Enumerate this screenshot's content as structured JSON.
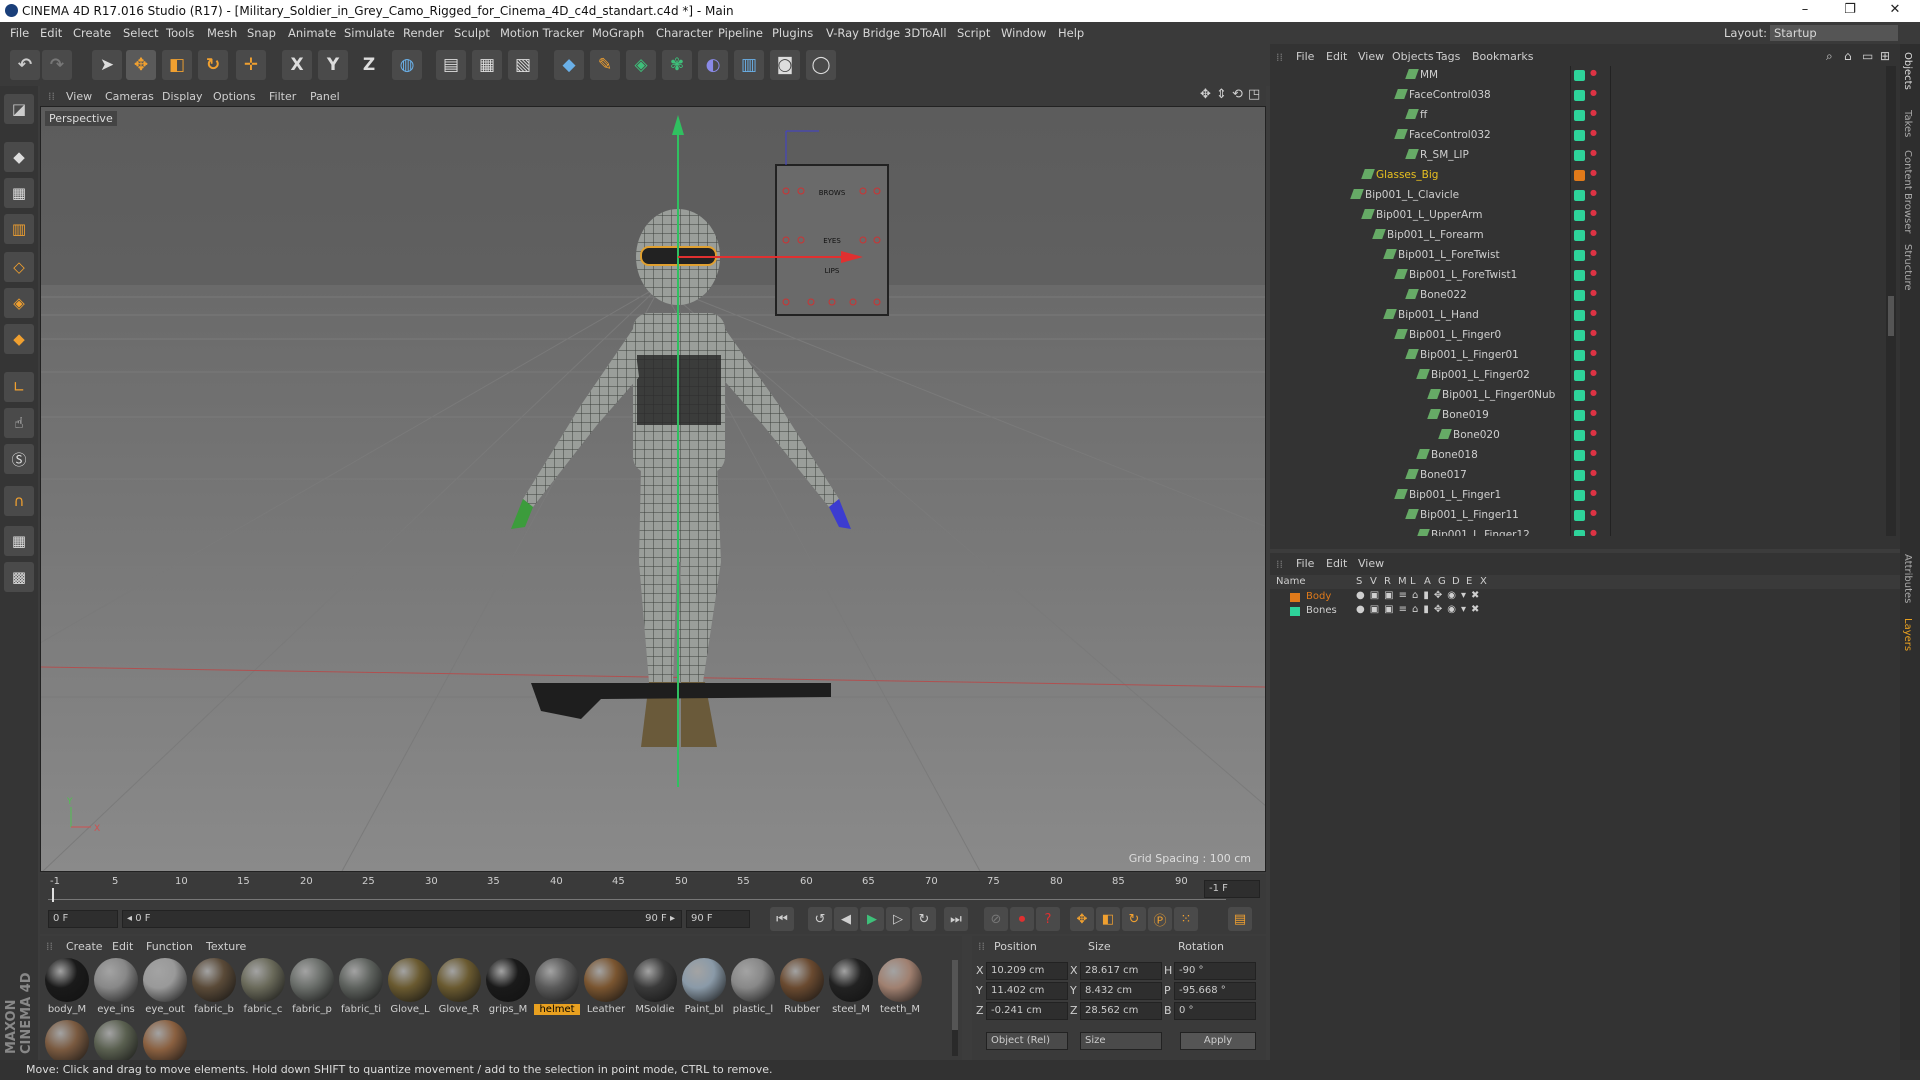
{
  "window": {
    "title": "CINEMA 4D R17.016 Studio (R17) - [Military_Soldier_in_Grey_Camo_Rigged_for_Cinema_4D_c4d_standart.c4d *] - Main",
    "minimize": "–",
    "restore": "❐",
    "close": "✕"
  },
  "menu": [
    "File",
    "Edit",
    "Create",
    "Select",
    "Tools",
    "Mesh",
    "Snap",
    "Animate",
    "Simulate",
    "Render",
    "Sculpt",
    "Motion Tracker",
    "MoGraph",
    "Character",
    "Pipeline",
    "Plugins",
    "V-Ray Bridge",
    "3DToAll",
    "Script",
    "Window",
    "Help"
  ],
  "layout": {
    "label": "Layout:",
    "value": "Startup"
  },
  "toolbar": {
    "x": "X",
    "y": "Y",
    "z": "Z"
  },
  "viewport": {
    "menu": [
      "View",
      "Cameras",
      "Display",
      "Options",
      "Filter",
      "Panel"
    ],
    "name": "Perspective",
    "grid_spacing": "Grid Spacing : 100 cm",
    "axis_y": "Y",
    "axis_x": "X",
    "face_panel": [
      "BROWS",
      "EYES",
      "LIPS"
    ]
  },
  "timeline": {
    "ticks": [
      "-1",
      "5",
      "10",
      "15",
      "20",
      "25",
      "30",
      "35",
      "40",
      "45",
      "50",
      "55",
      "60",
      "65",
      "70",
      "75",
      "80",
      "85",
      "90"
    ],
    "end": "-1 F"
  },
  "playback": {
    "current": "0 F",
    "range_start": "◂ 0 F",
    "range_end": "90 F ▸",
    "end": "90 F"
  },
  "materials": {
    "menu": [
      "Create",
      "Edit",
      "Function",
      "Texture"
    ],
    "items": [
      {
        "name": "body_M",
        "color": "#1a1a1a"
      },
      {
        "name": "eye_ins",
        "color": "#888"
      },
      {
        "name": "eye_out",
        "color": "#999"
      },
      {
        "name": "fabric_b",
        "color": "#5a4a38"
      },
      {
        "name": "fabric_c",
        "color": "#6a6a5a"
      },
      {
        "name": "fabric_p",
        "color": "#6a6e6a"
      },
      {
        "name": "fabric_ti",
        "color": "#5e625e"
      },
      {
        "name": "Glove_L",
        "color": "#6a5a30"
      },
      {
        "name": "Glove_R",
        "color": "#6a5a30"
      },
      {
        "name": "grips_M",
        "color": "#1a1a1a"
      },
      {
        "name": "helmet",
        "color": "#5a5a5a"
      },
      {
        "name": "Leather",
        "color": "#7a5530"
      },
      {
        "name": "MSoldie",
        "color": "#3a3a3a"
      },
      {
        "name": "Paint_bl",
        "color": "#8a9aa8"
      },
      {
        "name": "plastic_l",
        "color": "#888"
      },
      {
        "name": "Rubber",
        "color": "#6a4a30"
      },
      {
        "name": "steel_M",
        "color": "#222"
      },
      {
        "name": "teeth_M",
        "color": "#a08070"
      },
      {
        "name": "",
        "color": "#7a5a40"
      },
      {
        "name": "",
        "color": "#5a6050"
      },
      {
        "name": "",
        "color": "#8a6040"
      }
    ],
    "selected": "helmet"
  },
  "attributes": {
    "headers": [
      "Position",
      "Size",
      "Rotation"
    ],
    "rows": [
      {
        "a": "X",
        "pos": "10.209 cm",
        "b": "X",
        "size": "28.617 cm",
        "c": "H",
        "rot": "-90 °"
      },
      {
        "a": "Y",
        "pos": "11.402 cm",
        "b": "Y",
        "size": "8.432 cm",
        "c": "P",
        "rot": "-95.668 °"
      },
      {
        "a": "Z",
        "pos": "-0.241 cm",
        "b": "Z",
        "size": "28.562 cm",
        "c": "B",
        "rot": "0 °"
      }
    ],
    "mode": "Object (Rel)",
    "size_mode": "Size",
    "apply": "Apply"
  },
  "objects": {
    "menu": [
      "File",
      "Edit",
      "View",
      "Objects",
      "Tags",
      "Bookmarks"
    ],
    "rows": [
      {
        "name": "MM",
        "indent": 7
      },
      {
        "name": "FaceControl038",
        "indent": 6
      },
      {
        "name": "ff",
        "indent": 7
      },
      {
        "name": "FaceControl032",
        "indent": 6
      },
      {
        "name": "R_SM_LIP",
        "indent": 7
      },
      {
        "name": "Glasses_Big",
        "indent": 3,
        "highlight": true
      },
      {
        "name": "Bip001_L_Clavicle",
        "indent": 2
      },
      {
        "name": "Bip001_L_UpperArm",
        "indent": 3
      },
      {
        "name": "Bip001_L_Forearm",
        "indent": 4
      },
      {
        "name": "Bip001_L_ForeTwist",
        "indent": 5
      },
      {
        "name": "Bip001_L_ForeTwist1",
        "indent": 6
      },
      {
        "name": "Bone022",
        "indent": 7
      },
      {
        "name": "Bip001_L_Hand",
        "indent": 5
      },
      {
        "name": "Bip001_L_Finger0",
        "indent": 6
      },
      {
        "name": "Bip001_L_Finger01",
        "indent": 7
      },
      {
        "name": "Bip001_L_Finger02",
        "indent": 8
      },
      {
        "name": "Bip001_L_Finger0Nub",
        "indent": 9
      },
      {
        "name": "Bone019",
        "indent": 9
      },
      {
        "name": "Bone020",
        "indent": 10
      },
      {
        "name": "Bone018",
        "indent": 8
      },
      {
        "name": "Bone017",
        "indent": 7
      },
      {
        "name": "Bip001_L_Finger1",
        "indent": 6
      },
      {
        "name": "Bip001_L_Finger11",
        "indent": 7
      },
      {
        "name": "Bip001_L_Finger12",
        "indent": 8
      }
    ]
  },
  "layers": {
    "menu": [
      "File",
      "Edit",
      "View"
    ],
    "headers": [
      "Name",
      "S",
      "V",
      "R",
      "M",
      "L",
      "A",
      "G",
      "D",
      "E",
      "X"
    ],
    "rows": [
      {
        "name": "Body",
        "color": "#e07a1a"
      },
      {
        "name": "Bones",
        "color": "#2ed39a"
      }
    ]
  },
  "right_tabs": [
    "Objects",
    "Takes",
    "Content Browser",
    "Structure",
    "Attributes",
    "Layers"
  ],
  "status": "Move: Click and drag to move elements. Hold down SHIFT to quantize movement / add to the selection in point mode, CTRL to remove.",
  "brand": "MAXON CINEMA 4D"
}
